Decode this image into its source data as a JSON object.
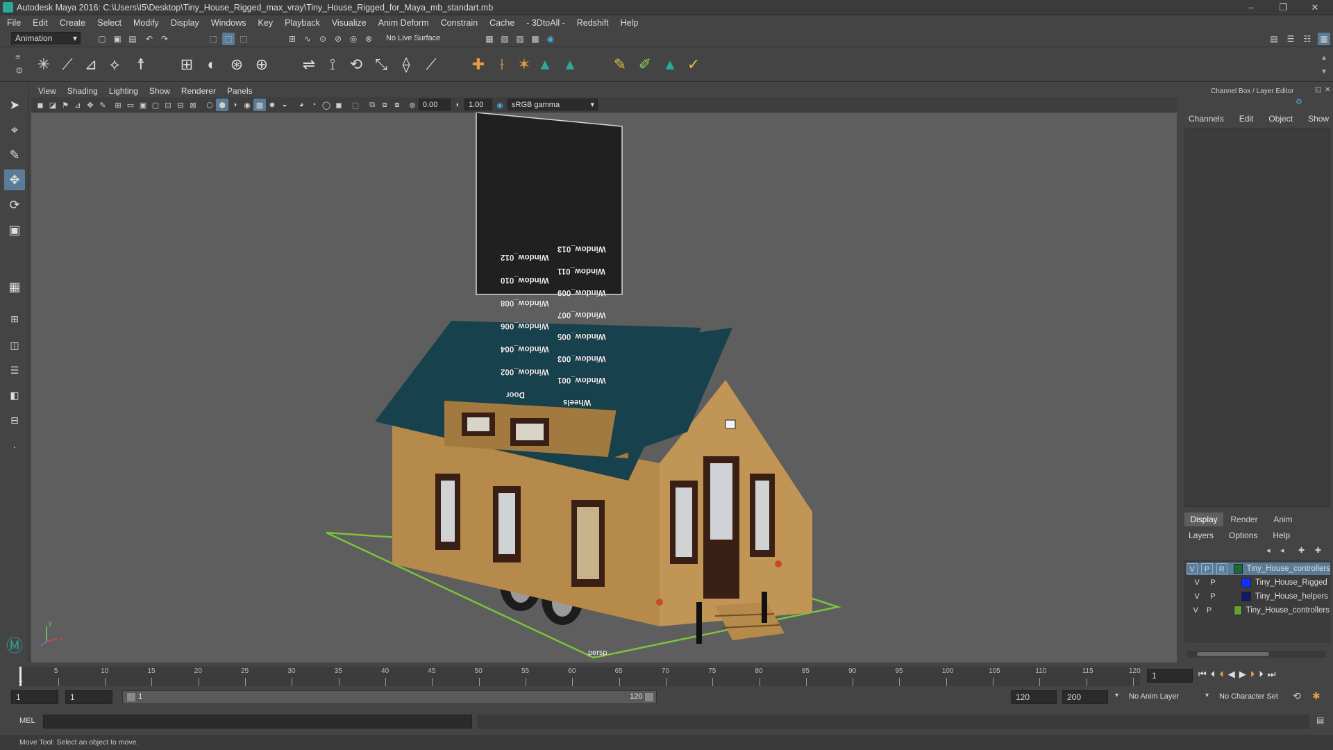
{
  "window": {
    "title": "Autodesk Maya 2016: C:\\Users\\I5\\Desktop\\Tiny_House_Rigged_max_vray\\Tiny_House_Rigged_for_Maya_mb_standart.mb",
    "minimize": "–",
    "maximize": "❐",
    "close": "✕"
  },
  "menus": [
    "File",
    "Edit",
    "Create",
    "Select",
    "Modify",
    "Display",
    "Windows",
    "Key",
    "Playback",
    "Visualize",
    "Anim Deform",
    "Constrain",
    "Cache",
    "- 3DtoAll -",
    "Redshift",
    "Help"
  ],
  "status": {
    "mode": "Animation",
    "live_surface": "No Live Surface"
  },
  "panel_menus": [
    "View",
    "Shading",
    "Lighting",
    "Show",
    "Renderer",
    "Panels"
  ],
  "panel_toolbar": {
    "exposure": "0.00",
    "gamma": "1.00",
    "colorspace": "sRGB gamma"
  },
  "viewport": {
    "camera": "persp",
    "axis_y": "y",
    "axis_x": "x"
  },
  "controller_board": {
    "labels_left": [
      "Window_012",
      "Window_010",
      "Window_008",
      "Window_006",
      "Window_004",
      "Window_002",
      "Door"
    ],
    "labels_right": [
      "Window_013",
      "Window_011",
      "Window_009",
      "Window_007",
      "Window_005",
      "Window_003",
      "Window_001",
      "Wheels"
    ]
  },
  "channel_box": {
    "title": "Channel Box / Layer Editor",
    "menus": [
      "Channels",
      "Edit",
      "Object",
      "Show"
    ]
  },
  "layer_editor": {
    "tabs": [
      "Display",
      "Render",
      "Anim"
    ],
    "menus": [
      "Layers",
      "Options",
      "Help"
    ],
    "layers": [
      {
        "v": "V",
        "p": "P",
        "r": "R",
        "color": "#1a6b3a",
        "name": "Tiny_House_controllers",
        "selected": true
      },
      {
        "v": "V",
        "p": "P",
        "r": "",
        "color": "#1030ff",
        "name": "Tiny_House_Rigged",
        "selected": false
      },
      {
        "v": "V",
        "p": "P",
        "r": "",
        "color": "#101a6a",
        "name": "Tiny_House_helpers",
        "selected": false
      },
      {
        "v": "V",
        "p": "P",
        "r": "",
        "color": "#6aa030",
        "name": "Tiny_House_controllers",
        "selected": false
      }
    ]
  },
  "timeline": {
    "ticks": [
      "5",
      "10",
      "15",
      "20",
      "25",
      "30",
      "35",
      "40",
      "45",
      "50",
      "55",
      "60",
      "65",
      "70",
      "75",
      "80",
      "85",
      "90",
      "95",
      "100",
      "105",
      "110",
      "115",
      "120"
    ],
    "start_label": "1",
    "current_frame": "1"
  },
  "range": {
    "start": "1",
    "anim_start": "1",
    "slider_start": "1",
    "slider_end": "120",
    "anim_end": "120",
    "end": "200",
    "anim_layer": "No Anim Layer",
    "char_set": "No Character Set"
  },
  "cmd": {
    "label": "MEL"
  },
  "help": {
    "text": "Move Tool: Select an object to move."
  }
}
